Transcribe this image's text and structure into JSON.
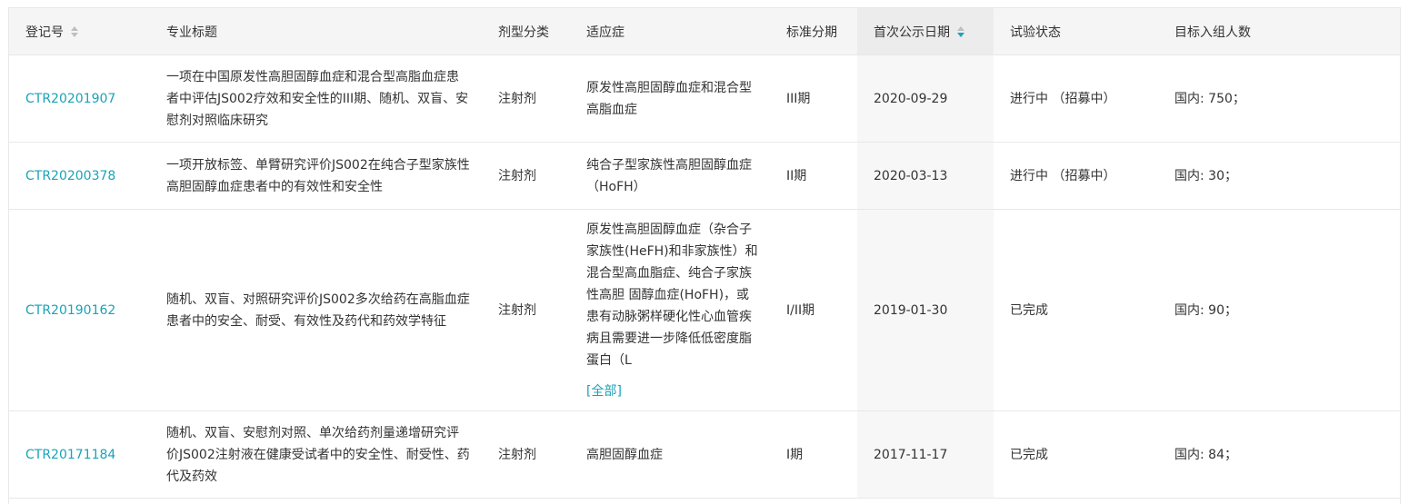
{
  "columns": {
    "reg_no": "登记号",
    "title": "专业标题",
    "dosage": "剂型分类",
    "indication": "适应症",
    "phase": "标准分期",
    "first_date": "首次公示日期",
    "status": "试验状态",
    "enroll": "目标入组人数"
  },
  "rows": [
    {
      "reg_no": "CTR20201907",
      "title": "一项在中国原发性高胆固醇血症和混合型高脂血症患者中评估JS002疗效和安全性的III期、随机、双盲、安慰剂对照临床研究",
      "dosage": "注射剂",
      "indication": "原发性高胆固醇血症和混合型高脂血症",
      "phase": "III期",
      "first_date": "2020-09-29",
      "status": "进行中 （招募中）",
      "enroll": "国内: 750；"
    },
    {
      "reg_no": "CTR20200378",
      "title": "一项开放标签、单臂研究评价JS002在纯合子型家族性高胆固醇血症患者中的有效性和安全性",
      "dosage": "注射剂",
      "indication": "纯合子型家族性高胆固醇血症（HoFH）",
      "phase": "II期",
      "first_date": "2020-03-13",
      "status": "进行中 （招募中）",
      "enroll": "国内: 30；"
    },
    {
      "reg_no": "CTR20190162",
      "title": "随机、双盲、对照研究评价JS002多次给药在高脂血症患者中的安全、耐受、有效性及药代和药效学特征",
      "dosage": "注射剂",
      "indication": "原发性高胆固醇血症（杂合子家族性(HeFH)和非家族性）和混合型高血脂症、纯合子家族性高胆 固醇血症(HoFH)，或患有动脉粥样硬化性心血管疾病且需要进一步降低低密度脂蛋白（L",
      "more": "[全部]",
      "phase": "I/II期",
      "first_date": "2019-01-30",
      "status": "已完成",
      "enroll": "国内: 90；"
    },
    {
      "reg_no": "CTR20171184",
      "title": "随机、双盲、安慰剂对照、单次给药剂量递增研究评价JS002注射液在健康受试者中的安全性、耐受性、药代及药效",
      "dosage": "注射剂",
      "indication": "高胆固醇血症",
      "phase": "I期",
      "first_date": "2017-11-17",
      "status": "已完成",
      "enroll": "国内: 84；"
    }
  ],
  "colors": {
    "link": "#1aa3b8",
    "header_bg": "#f5f5f5",
    "border": "#e8e8e8"
  }
}
